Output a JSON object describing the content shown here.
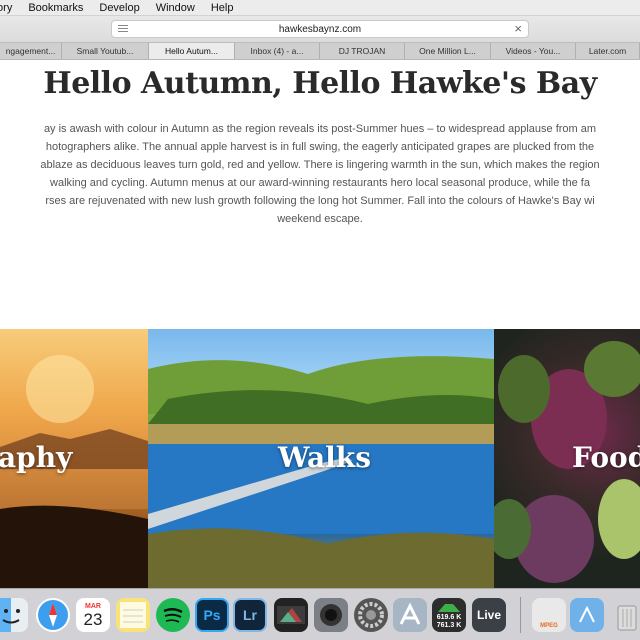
{
  "menubar": {
    "items": [
      "tory",
      "Bookmarks",
      "Develop",
      "Window",
      "Help"
    ]
  },
  "toolbar": {
    "address": "hawkesbaynz.com"
  },
  "tabs": [
    "ngagement...",
    "Small Youtub...",
    "Hello Autum...",
    "Inbox (4) - a...",
    "DJ TROJAN",
    "One Million L...",
    "Videos - You...",
    "Later.com"
  ],
  "page": {
    "title": "Hello Autumn, Hello Hawke's Bay",
    "intro_lines": [
      "ay is awash with colour in Autumn as the region reveals its post-Summer hues – to widespread applause from am",
      "hotographers alike. The annual apple harvest is in full swing, the eagerly anticipated grapes are plucked from the",
      "ablaze as deciduous leaves turn gold, red and yellow. There is lingering warmth in the sun, which makes the region",
      "walking and cycling. Autumn menus at our award-winning restaurants hero local seasonal produce, while the fa",
      "rses are rejuvenated with new lush growth following the long hot Summer. Fall into the colours of Hawke's Bay wi",
      "weekend escape."
    ],
    "cards": [
      {
        "label": "aphy"
      },
      {
        "label": "Walks"
      },
      {
        "label": "Food"
      }
    ]
  },
  "dock": {
    "calendar_month": "MAR",
    "calendar_day": "23",
    "ps_label": "Ps",
    "lr_label": "Lr",
    "istat_up": "619.6 K",
    "istat_down": "761.3 K",
    "live_label": "Live",
    "mpeg_label": "MPEG"
  }
}
